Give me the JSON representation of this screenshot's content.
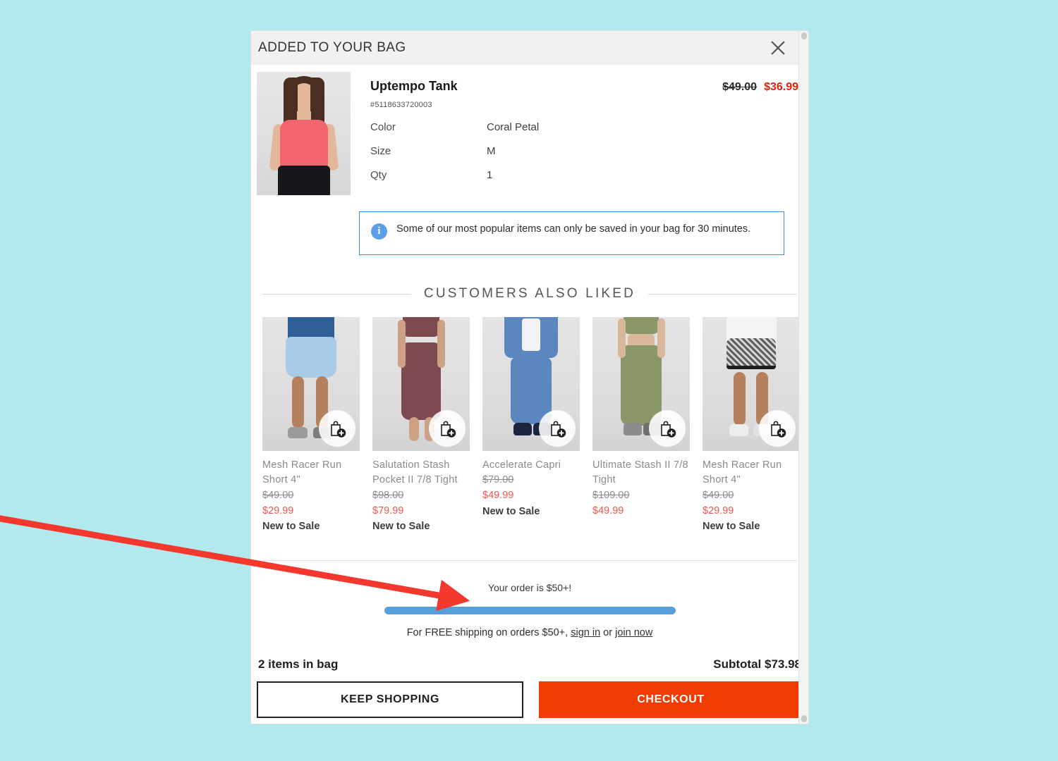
{
  "background_color": "#b2e9ec",
  "modal": {
    "header": {
      "title": "ADDED TO YOUR BAG",
      "close_icon": "close-icon"
    },
    "product": {
      "name": "Uptempo Tank",
      "sku": "#5118633720003",
      "price_was": "$49.00",
      "price_now": "$36.99",
      "attributes": [
        {
          "label": "Color",
          "value": "Coral Petal"
        },
        {
          "label": "Size",
          "value": "M"
        },
        {
          "label": "Qty",
          "value": "1"
        }
      ]
    },
    "notice": {
      "icon": "info-icon",
      "text": "Some of our most popular items can only be saved in your bag for 30 minutes."
    },
    "recommendations": {
      "title": "CUSTOMERS ALSO LIKED",
      "add_icon": "add-to-bag-icon",
      "items": [
        {
          "name": "Mesh Racer Run Short 4\"",
          "price_was": "$49.00",
          "price_now": "$29.99",
          "badge": "New to Sale"
        },
        {
          "name": "Salutation Stash Pocket II 7/8 Tight",
          "price_was": "$98.00",
          "price_now": "$79.99",
          "badge": "New to Sale"
        },
        {
          "name": "Accelerate Capri",
          "price_was": "$79.00",
          "price_now": "$49.99",
          "badge": "New to Sale"
        },
        {
          "name": "Ultimate Stash II 7/8 Tight",
          "price_was": "$109.00",
          "price_now": "$49.99",
          "badge": ""
        },
        {
          "name": "Mesh Racer Run Short 4\"",
          "price_was": "$49.00",
          "price_now": "$29.99",
          "badge": "New to Sale"
        }
      ]
    },
    "shipping": {
      "status": "Your order is $50+!",
      "progress_percent": 100,
      "note_prefix": "For FREE shipping on orders $50+, ",
      "sign_in_label": "sign in",
      "note_middle": " or ",
      "join_now_label": "join now"
    },
    "footer": {
      "bag_count": "2 items in bag",
      "subtotal": "Subtotal $73.98",
      "keep_shopping_label": "KEEP SHOPPING",
      "checkout_label": "CHECKOUT",
      "checkout_color": "#f03c02"
    }
  },
  "annotation": {
    "arrow_color": "#f4382e"
  }
}
